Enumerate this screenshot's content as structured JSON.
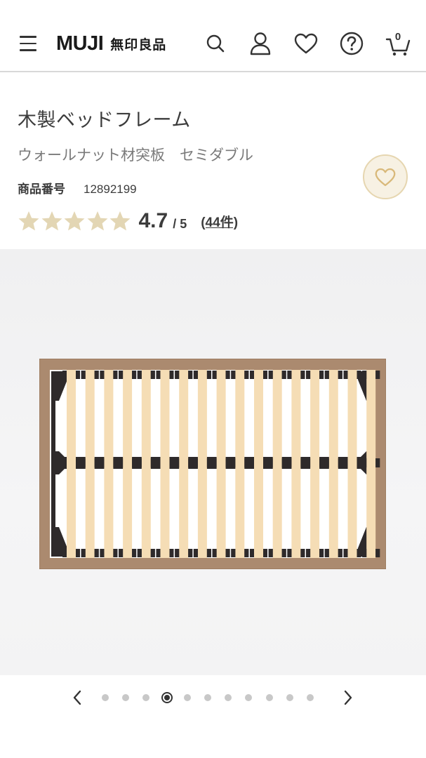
{
  "header": {
    "logo_en": "MUJI",
    "logo_jp": "無印良品",
    "cart_count": "0",
    "icons": [
      "hamburger-menu-icon",
      "search-icon",
      "user-icon",
      "heart-icon",
      "help-icon",
      "cart-icon"
    ]
  },
  "product": {
    "title": "木製ベッドフレーム",
    "subtitle": "ウォールナット材突板　セミダブル",
    "code_label": "商品番号",
    "code_value": "12892199",
    "rating": {
      "score": "4.7",
      "out_of": "/ 5",
      "reviews": "(44件)",
      "stars_filled": 5
    },
    "favorite_icon": "heart-outline-icon"
  },
  "gallery": {
    "total_images": 11,
    "active_index": 3
  },
  "colors": {
    "star": "#e3d6b4",
    "favorite_bg": "#f7f1e3",
    "frame_wood": "#ab8a6f",
    "slat": "#f5ddb5",
    "dark_part": "#2e2a2b"
  }
}
